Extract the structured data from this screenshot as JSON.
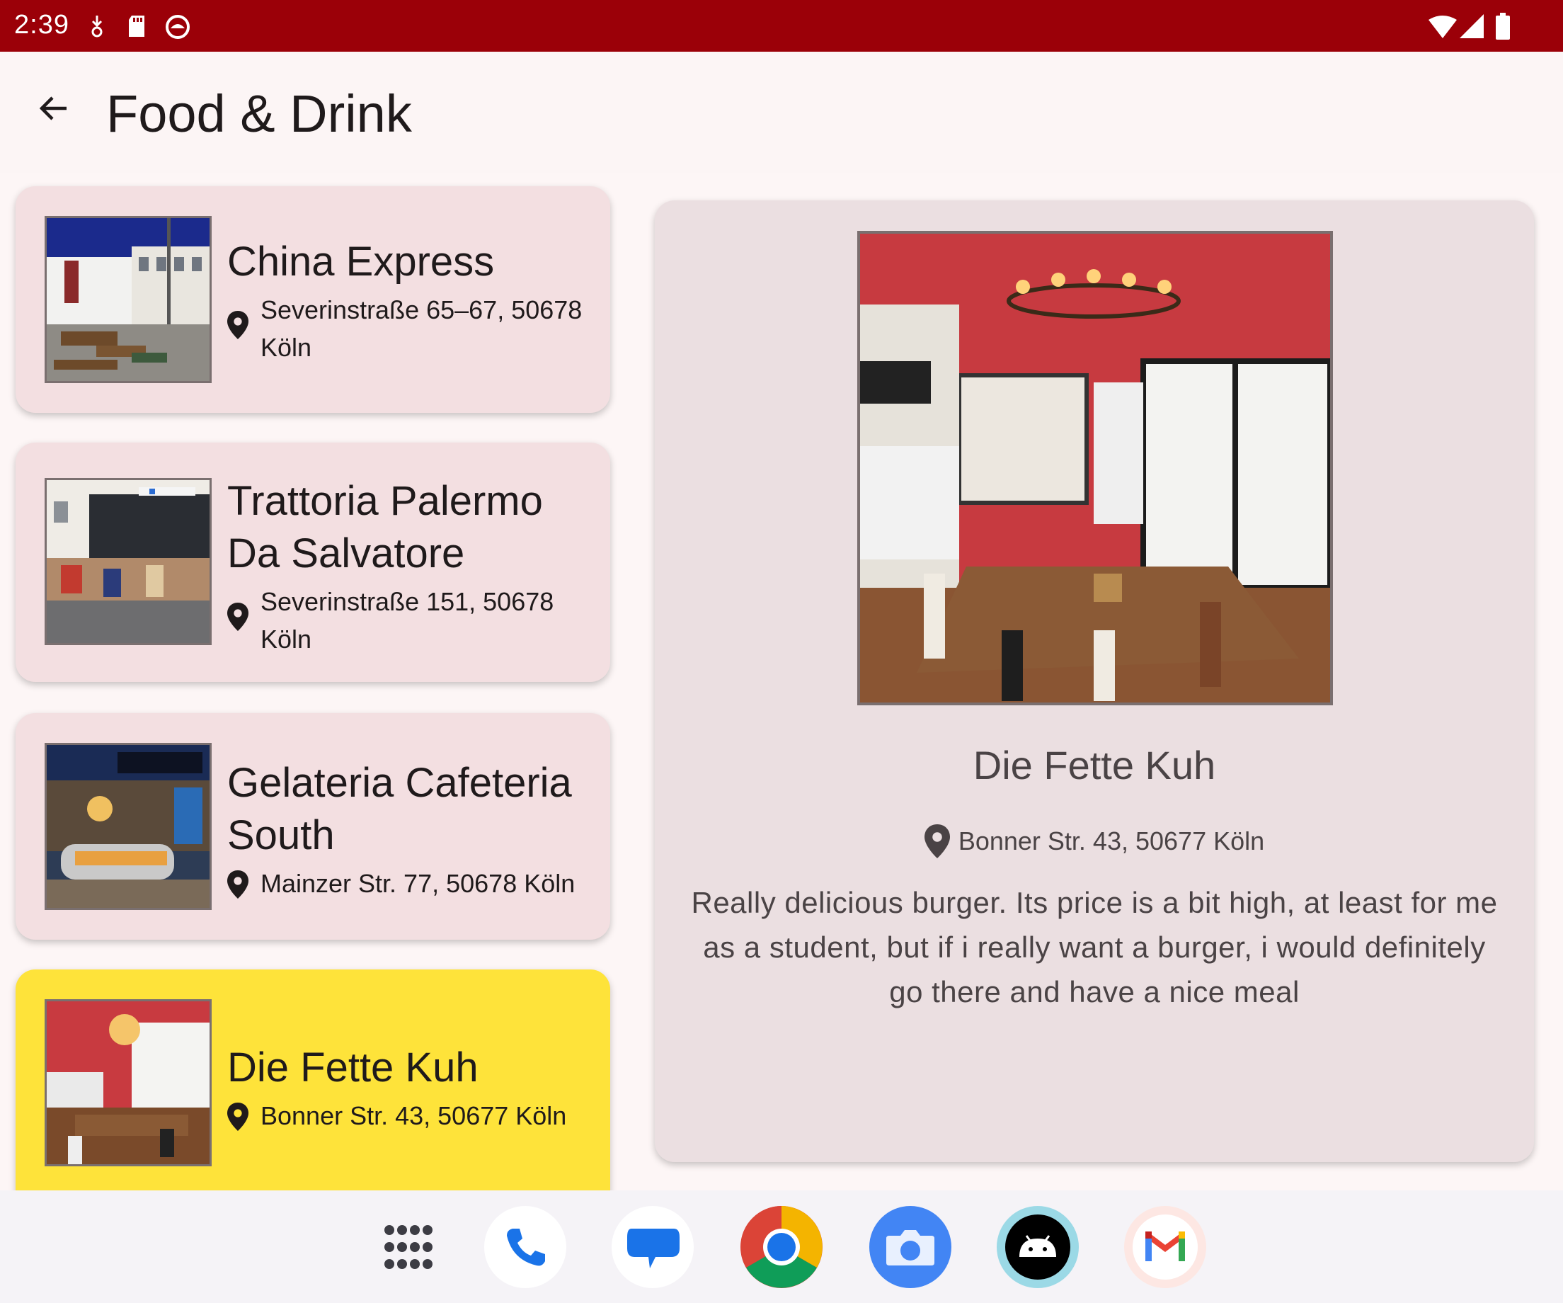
{
  "status_bar": {
    "time": "2:39",
    "left_icons": [
      "download-icon",
      "sd-card-icon",
      "android-face-icon"
    ],
    "right_icons": [
      "wifi-icon",
      "cell-signal-icon",
      "battery-icon"
    ],
    "background": "#9b0008"
  },
  "app_bar": {
    "title": "Food & Drink",
    "back_icon": "arrow-back-icon"
  },
  "list": {
    "items": [
      {
        "name": "China Express",
        "address": "Severinstraße 65–67, 50678 Köln",
        "selected": false
      },
      {
        "name": "Trattoria Palermo Da Salvatore",
        "address": "Severinstraße 151, 50678 Köln",
        "selected": false
      },
      {
        "name": "Gelateria Cafeteria South",
        "address": "Mainzer Str. 77, 50678 Köln",
        "selected": false
      },
      {
        "name": "Die Fette Kuh",
        "address": "Bonner Str. 43, 50677 Köln",
        "selected": true
      }
    ],
    "card_color": "#f3dfe1",
    "selected_color": "#fee33a"
  },
  "detail": {
    "name": "Die Fette Kuh",
    "address": "Bonner Str. 43, 50677 Köln",
    "description": "Really delicious burger. Its price is a bit high, at least for me as a student, but if i really want a burger, i would definitely go there and have a nice meal"
  },
  "dock": {
    "apps": [
      "app-drawer-icon",
      "phone-icon",
      "messages-icon",
      "chrome-icon",
      "camera-icon",
      "android-icon",
      "gmail-icon"
    ]
  }
}
